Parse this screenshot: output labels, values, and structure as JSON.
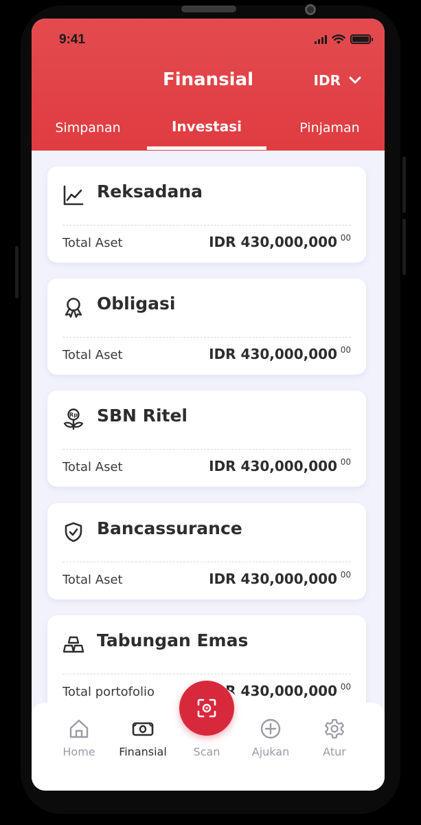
{
  "status_bar": {
    "time": "9:41"
  },
  "header": {
    "title": "Finansial",
    "currency": "IDR",
    "tabs": [
      {
        "label": "Simpanan",
        "active": false
      },
      {
        "label": "Investasi",
        "active": true
      },
      {
        "label": "Pinjaman",
        "active": false
      }
    ]
  },
  "cards": [
    {
      "title": "Reksadana",
      "icon": "chart-line-icon",
      "label": "Total Aset",
      "value": "IDR 430,000,000",
      "cents": "00"
    },
    {
      "title": "Obligasi",
      "icon": "award-ribbon-icon",
      "label": "Total Aset",
      "value": "IDR 430,000,000",
      "cents": "00"
    },
    {
      "title": "SBN Ritel",
      "icon": "rupiah-plant-icon",
      "label": "Total Aset",
      "value": "IDR 430,000,000",
      "cents": "00"
    },
    {
      "title": "Bancassurance",
      "icon": "shield-check-icon",
      "label": "Total Aset",
      "value": "IDR 430,000,000",
      "cents": "00"
    },
    {
      "title": "Tabungan Emas",
      "icon": "gold-bars-icon",
      "label": "Total portofolio",
      "value": "IDR 430,000,000",
      "cents": "00"
    }
  ],
  "bottom_nav": {
    "items": [
      {
        "label": "Home",
        "icon": "home-icon",
        "active": false
      },
      {
        "label": "Finansial",
        "icon": "wallet-icon",
        "active": true
      },
      {
        "label": "Scan",
        "icon": "scan-icon",
        "active": false
      },
      {
        "label": "Ajukan",
        "icon": "plus-circle-icon",
        "active": false
      },
      {
        "label": "Atur",
        "icon": "gear-icon",
        "active": false
      }
    ]
  },
  "colors": {
    "header_red": "#e24b4f",
    "scan_button": "#d8293c",
    "background": "#f1f2fb",
    "text_dark": "#2d2d2d",
    "nav_inactive": "#9b9ba3"
  }
}
